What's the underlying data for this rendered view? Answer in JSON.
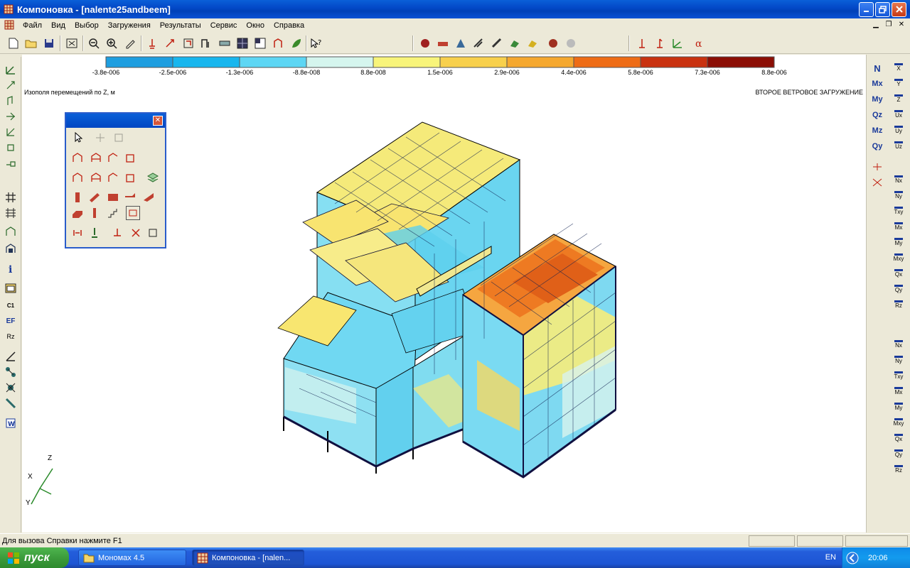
{
  "window": {
    "title": "Компоновка - [nalente25andbeem]"
  },
  "menu": [
    "Файл",
    "Вид",
    "Выбор",
    "Загружения",
    "Результаты",
    "Сервис",
    "Окно",
    "Справка"
  ],
  "legend": {
    "colors": [
      "#1e9ee0",
      "#18b6ee",
      "#5dd6f4",
      "#d5f5ee",
      "#f8f47a",
      "#f8d04c",
      "#f5a82f",
      "#ee6c16",
      "#c93210",
      "#8b0e05"
    ],
    "labels": [
      "-3.8e-006",
      "-2.5e-006",
      "-1.3e-006",
      "-8.8e-008",
      "8.8e-008",
      "1.5e-006",
      "2.9e-006",
      "4.4e-006",
      "5.8e-006",
      "7.3e-006",
      "8.8e-006"
    ]
  },
  "canvas": {
    "caption_left": "Изополя перемещений по Z, м",
    "caption_right": "ВТОРОЕ ВЕТРОВОЕ ЗАГРУЖЕНИЕ",
    "axes": {
      "z": "Z",
      "x": "X",
      "y": "Y"
    }
  },
  "right_panel_1": [
    "N",
    "Mx",
    "My",
    "Qz",
    "Mz",
    "Qy"
  ],
  "right_panel_2": [
    "X",
    "Y",
    "Z",
    "Ux",
    "Uy",
    "Uz",
    "Nx",
    "Ny",
    "Txy",
    "Mx",
    "My",
    "Mxy",
    "Qx",
    "Qy",
    "Rz",
    "Nx",
    "Ny",
    "Txy",
    "Mx",
    "My",
    "Mxy",
    "Qx",
    "Qy",
    "Rz"
  ],
  "left_panel": [
    "C1",
    "EF",
    "Rz"
  ],
  "status": {
    "text": "Для вызова Справки нажмите F1"
  },
  "taskbar": {
    "start": "пуск",
    "items": [
      {
        "label": "Мономах 4.5",
        "active": false
      },
      {
        "label": "Компоновка - [nalen...",
        "active": true
      }
    ],
    "lang": "EN",
    "clock": "20:06"
  }
}
